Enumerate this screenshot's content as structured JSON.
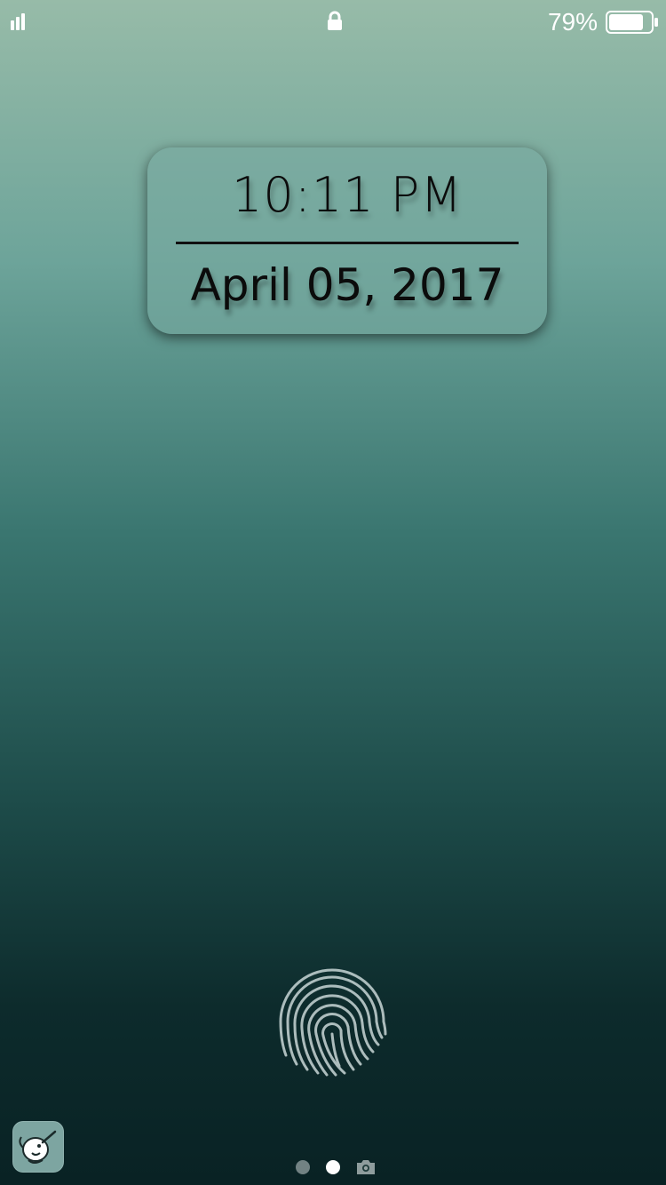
{
  "status_bar": {
    "signal_icon": "signal-bars-icon",
    "lock_icon": "lock-icon",
    "battery_percent": "79%",
    "battery_level": 0.79,
    "battery_icon": "battery-icon"
  },
  "clock": {
    "time": "10:11 PM",
    "date": "April 05, 2017"
  },
  "fingerprint": {
    "icon": "fingerprint-icon"
  },
  "dock": {
    "app_icon": "narwhal-app-icon"
  },
  "page_indicator": {
    "pages": 3,
    "current_page": 2,
    "camera_icon": "camera-icon"
  },
  "colors": {
    "gradient_top": "#97bba8",
    "gradient_bottom": "#092224",
    "text_dark": "#0b0b0b",
    "status_text": "#ffffff"
  }
}
